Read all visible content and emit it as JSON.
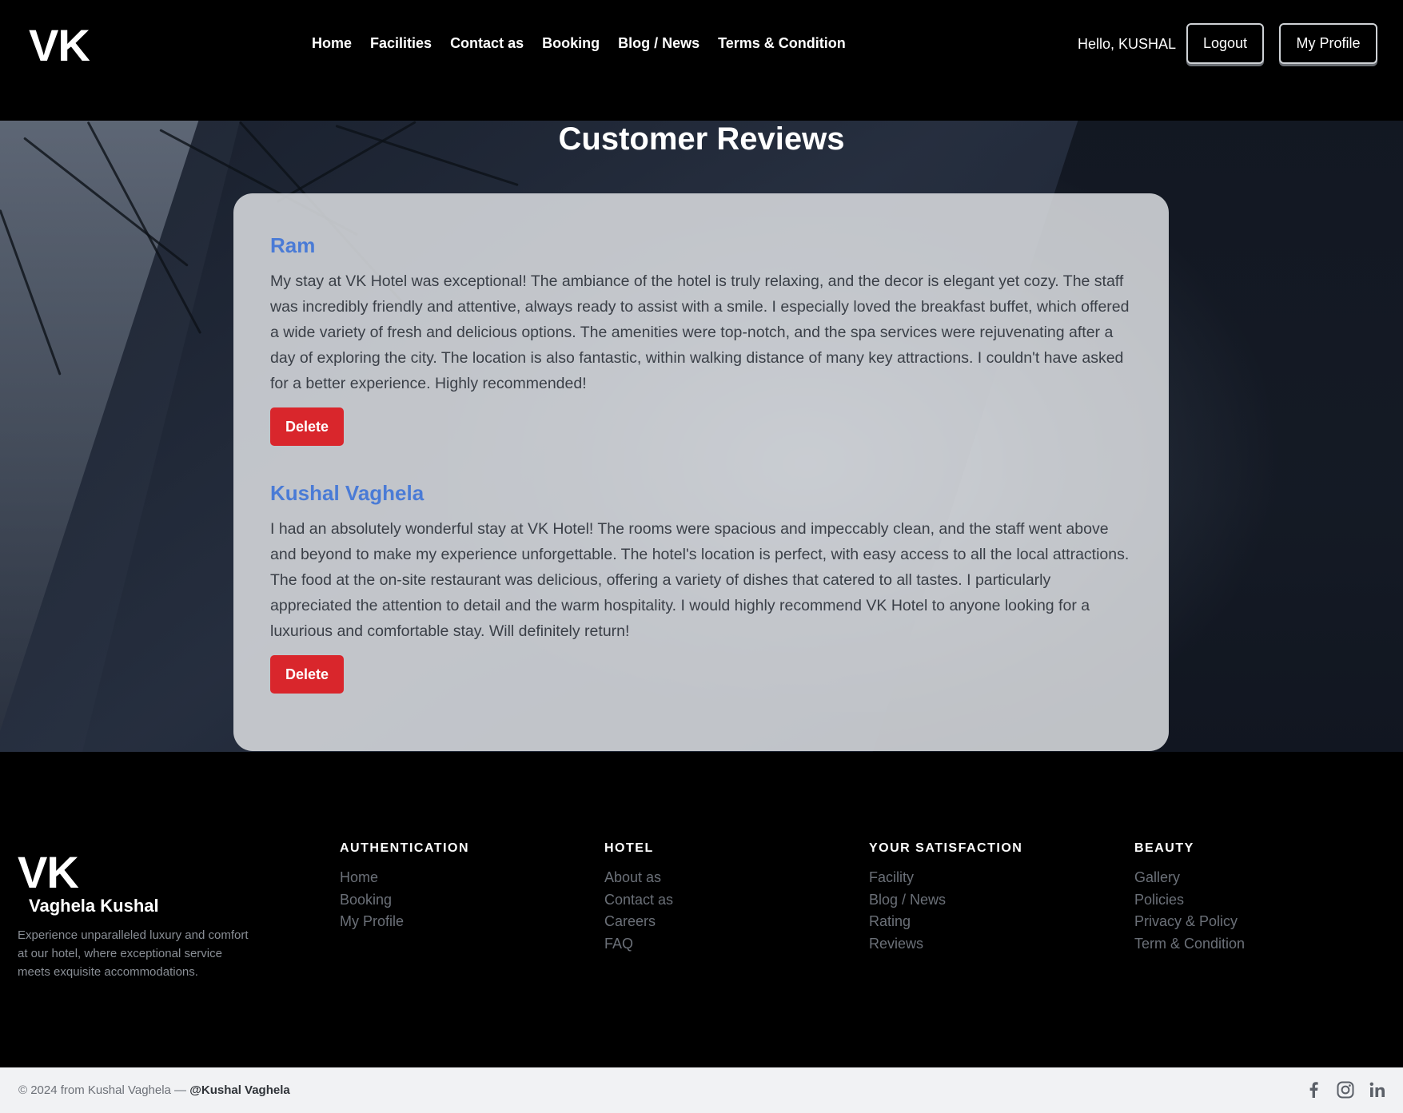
{
  "header": {
    "brand": "VK",
    "nav": [
      "Home",
      "Facilities",
      "Contact as",
      "Booking",
      "Blog / News",
      "Terms & Condition"
    ],
    "greeting": "Hello, KUSHAL",
    "logout_label": "Logout",
    "profile_label": "My Profile"
  },
  "reviews_section": {
    "title": "Customer Reviews",
    "reviews": [
      {
        "name": "Ram",
        "text": "My stay at VK Hotel was exceptional! The ambiance of the hotel is truly relaxing, and the decor is elegant yet cozy. The staff was incredibly friendly and attentive, always ready to assist with a smile. I especially loved the breakfast buffet, which offered a wide variety of fresh and delicious options. The amenities were top-notch, and the spa services were rejuvenating after a day of exploring the city. The location is also fantastic, within walking distance of many key attractions. I couldn't have asked for a better experience. Highly recommended!",
        "delete_label": "Delete"
      },
      {
        "name": "Kushal Vaghela",
        "text": "I had an absolutely wonderful stay at VK Hotel! The rooms were spacious and impeccably clean, and the staff went above and beyond to make my experience unforgettable. The hotel's location is perfect, with easy access to all the local attractions. The food at the on-site restaurant was delicious, offering a variety of dishes that catered to all tastes. I particularly appreciated the attention to detail and the warm hospitality. I would highly recommend VK Hotel to anyone looking for a luxurious and comfortable stay. Will definitely return!",
        "delete_label": "Delete"
      }
    ]
  },
  "footer": {
    "logo": "VK",
    "name": "Vaghela Kushal",
    "description": "Experience unparalleled luxury and comfort at our hotel, where exceptional service meets exquisite accommodations.",
    "columns": [
      {
        "heading": "AUTHENTICATION",
        "links": [
          "Home",
          "Booking",
          "My Profile"
        ]
      },
      {
        "heading": "HOTEL",
        "links": [
          "About as",
          "Contact as",
          "Careers",
          "FAQ"
        ]
      },
      {
        "heading": "YOUR SATISFACTION",
        "links": [
          "Facility",
          "Blog / News",
          "Rating",
          "Reviews"
        ]
      },
      {
        "heading": "BEAUTY",
        "links": [
          "Gallery",
          "Policies",
          "Privacy & Policy",
          "Term & Condition"
        ]
      }
    ]
  },
  "bottom_bar": {
    "copyright": "© 2024 from Kushal Vaghela — ",
    "handle": "@Kushal Vaghela",
    "social_icons": [
      "facebook-icon",
      "instagram-icon",
      "linkedin-icon"
    ]
  },
  "colors": {
    "accent_name": "#4a7bd6",
    "delete_button": "#d9262c",
    "page_background": "#000000"
  }
}
